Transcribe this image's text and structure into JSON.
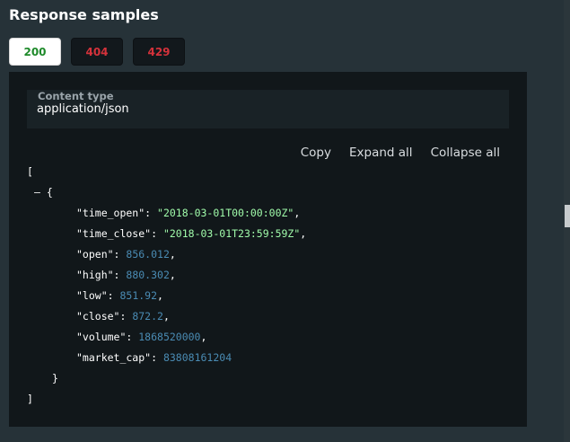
{
  "section_title": "Response samples",
  "tabs": [
    {
      "label": "200",
      "status": "success"
    },
    {
      "label": "404",
      "status": "error"
    },
    {
      "label": "429",
      "status": "error"
    }
  ],
  "content_type": {
    "label": "Content type",
    "value": "application/json"
  },
  "actions": {
    "copy": "Copy",
    "expand_all": "Expand all",
    "collapse_all": "Collapse all"
  },
  "json": {
    "open_bracket": "[",
    "collapse_toggle": "–",
    "open_brace": "{",
    "fields": [
      {
        "key": "\"time_open\"",
        "value": "\"2018-03-01T00:00:00Z\"",
        "type": "string"
      },
      {
        "key": "\"time_close\"",
        "value": "\"2018-03-01T23:59:59Z\"",
        "type": "string"
      },
      {
        "key": "\"open\"",
        "value": "856.012",
        "type": "number"
      },
      {
        "key": "\"high\"",
        "value": "880.302",
        "type": "number"
      },
      {
        "key": "\"low\"",
        "value": "851.92",
        "type": "number"
      },
      {
        "key": "\"close\"",
        "value": "872.2",
        "type": "number"
      },
      {
        "key": "\"volume\"",
        "value": "1868520000",
        "type": "number"
      },
      {
        "key": "\"market_cap\"",
        "value": "83808161204",
        "type": "number"
      }
    ],
    "close_brace": "}",
    "close_bracket": "]"
  },
  "colors": {
    "background": "#263238",
    "panel": "#11171a",
    "string": "#a0fbaa",
    "number": "#4a8bb3",
    "success": "#1e8a2a",
    "error": "#d4323b"
  }
}
